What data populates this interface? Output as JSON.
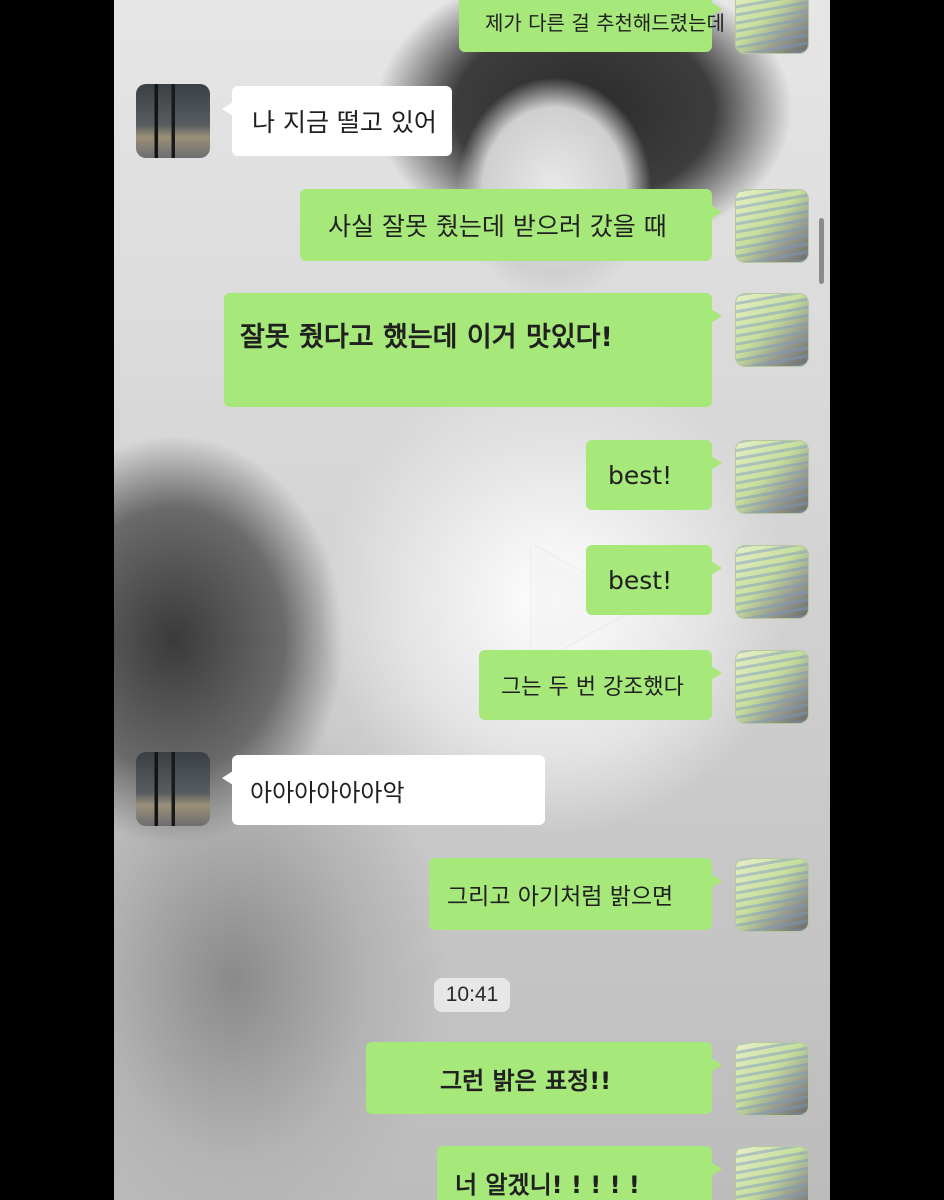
{
  "chat": {
    "timestamp": "10:41",
    "messages": [
      {
        "from": "me",
        "text": "제가 다른 걸 추천해드렸는데"
      },
      {
        "from": "them",
        "text": "나 지금 떨고 있어"
      },
      {
        "from": "me",
        "text": "사실 잘못 줬는데 받으러 갔을 때"
      },
      {
        "from": "me",
        "text": "잘못 줬다고 했는데 이거 맛있다!"
      },
      {
        "from": "me",
        "text": "best!"
      },
      {
        "from": "me",
        "text": "best!"
      },
      {
        "from": "me",
        "text": "그는 두 번 강조했다"
      },
      {
        "from": "them",
        "text": "아아아아아아악"
      },
      {
        "from": "me",
        "text": "그리고 아기처럼 밝으면"
      },
      {
        "from": "me",
        "text": "그런 밝은 표정!!"
      },
      {
        "from": "me",
        "text": "너 알겠니! ! ! ! !"
      }
    ]
  },
  "background": {
    "play_icon": "play-icon"
  },
  "colors": {
    "my_bubble": "#a6e87a",
    "their_bubble": "#ffffff"
  }
}
